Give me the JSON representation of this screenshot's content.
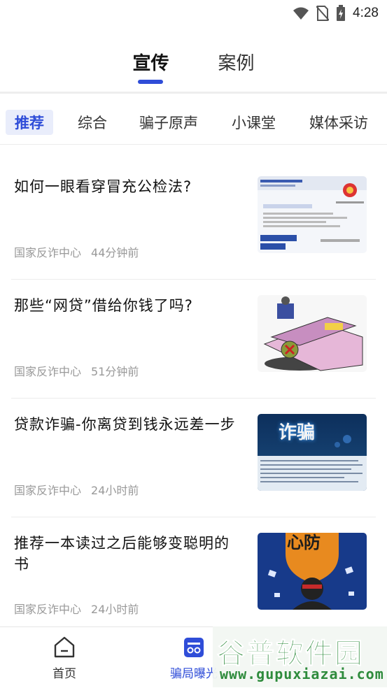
{
  "status_bar": {
    "time": "4:28",
    "icons": [
      "wifi-icon",
      "no-sim-icon",
      "battery-charging-icon"
    ]
  },
  "top_tabs": [
    {
      "label": "宣传",
      "active": true
    },
    {
      "label": "案例",
      "active": false
    }
  ],
  "categories": [
    {
      "label": "推荐",
      "active": true
    },
    {
      "label": "综合",
      "active": false
    },
    {
      "label": "骗子原声",
      "active": false
    },
    {
      "label": "小课堂",
      "active": false
    },
    {
      "label": "媒体采访",
      "active": false
    }
  ],
  "articles": [
    {
      "title": "如何一眼看穿冒充公检法?",
      "source": "国家反诈中心",
      "time": "44分钟前",
      "thumb_icon": "document-screenshot-image"
    },
    {
      "title": "那些“网贷”借给你钱了吗?",
      "source": "国家反诈中心",
      "time": "51分钟前",
      "thumb_icon": "loan-trap-illustration"
    },
    {
      "title": "贷款诈骗-你离贷到钱永远差一步",
      "source": "国家反诈中心",
      "time": "24小时前",
      "thumb_icon": "fraud-poster-image",
      "thumb_text": "诈骗"
    },
    {
      "title": "推荐一本读过之后能够变聪明的书",
      "source": "国家反诈中心",
      "time": "24小时前",
      "thumb_icon": "shield-hacker-illustration",
      "thumb_text": "心防"
    }
  ],
  "bottom_nav": [
    {
      "label": "首页",
      "icon": "home-icon",
      "active": false
    },
    {
      "label": "骗局曝光",
      "icon": "mask-icon",
      "active": true
    }
  ],
  "watermark": {
    "title": "谷普软件园",
    "url": "www.gupuxiazai.com"
  },
  "colors": {
    "accent": "#2f4dd8",
    "meta_text": "#999999"
  }
}
